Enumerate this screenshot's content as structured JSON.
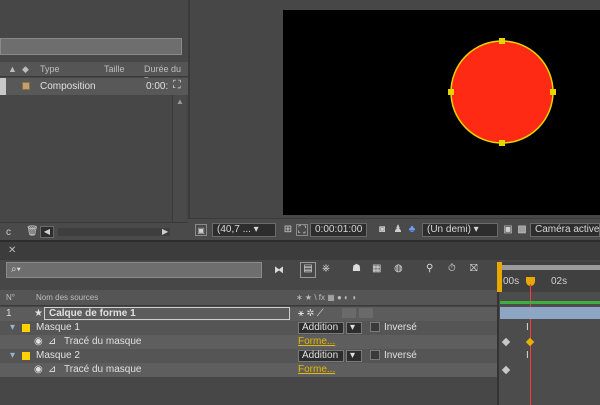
{
  "project_panel": {
    "columns": {
      "type": "Type",
      "size": "Taille",
      "duration": "Durée du n"
    },
    "item": {
      "name": "Composition",
      "duration": "0:00:"
    }
  },
  "viewer": {
    "zoom": "(40,7 ...",
    "timecode": "0:00:01:00",
    "resolution": "(Un demi)",
    "camera": "Caméra active",
    "shape_color": "#ff2a14",
    "shape_stroke": "#e8d400"
  },
  "timeline": {
    "search_placeholder": "⌕▾",
    "header": {
      "num": "N°",
      "source_name": "Nom des sources",
      "switches": "∗ ★ \\ fx ▦ ● ◐ ◑"
    },
    "time_labels": [
      "00s",
      "02s"
    ],
    "layers": [
      {
        "num": "1",
        "name": "Calque de forme 1"
      },
      {
        "name": "Masque 1",
        "mode": "Addition",
        "inverted": "Inversé"
      },
      {
        "name": "Tracé du masque",
        "value": "Forme..."
      },
      {
        "name": "Masque 2",
        "mode": "Addition",
        "inverted": "Inversé"
      },
      {
        "name": "Tracé du masque",
        "value": "Forme..."
      }
    ]
  }
}
